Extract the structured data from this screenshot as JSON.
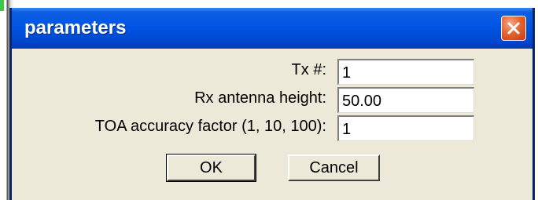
{
  "window": {
    "title": "parameters"
  },
  "form": {
    "fields": [
      {
        "label": "Tx #:",
        "value": "1"
      },
      {
        "label": "Rx antenna height:",
        "value": "50.00"
      },
      {
        "label": "TOA accuracy factor (1, 10, 100):",
        "value": "1"
      }
    ]
  },
  "buttons": {
    "ok_label": "OK",
    "cancel_label": "Cancel"
  },
  "icons": {
    "close": "close-icon"
  },
  "colors": {
    "titlebar": "#0055e5",
    "dialog_bg": "#ece9d8",
    "close_button": "#e6652f"
  }
}
